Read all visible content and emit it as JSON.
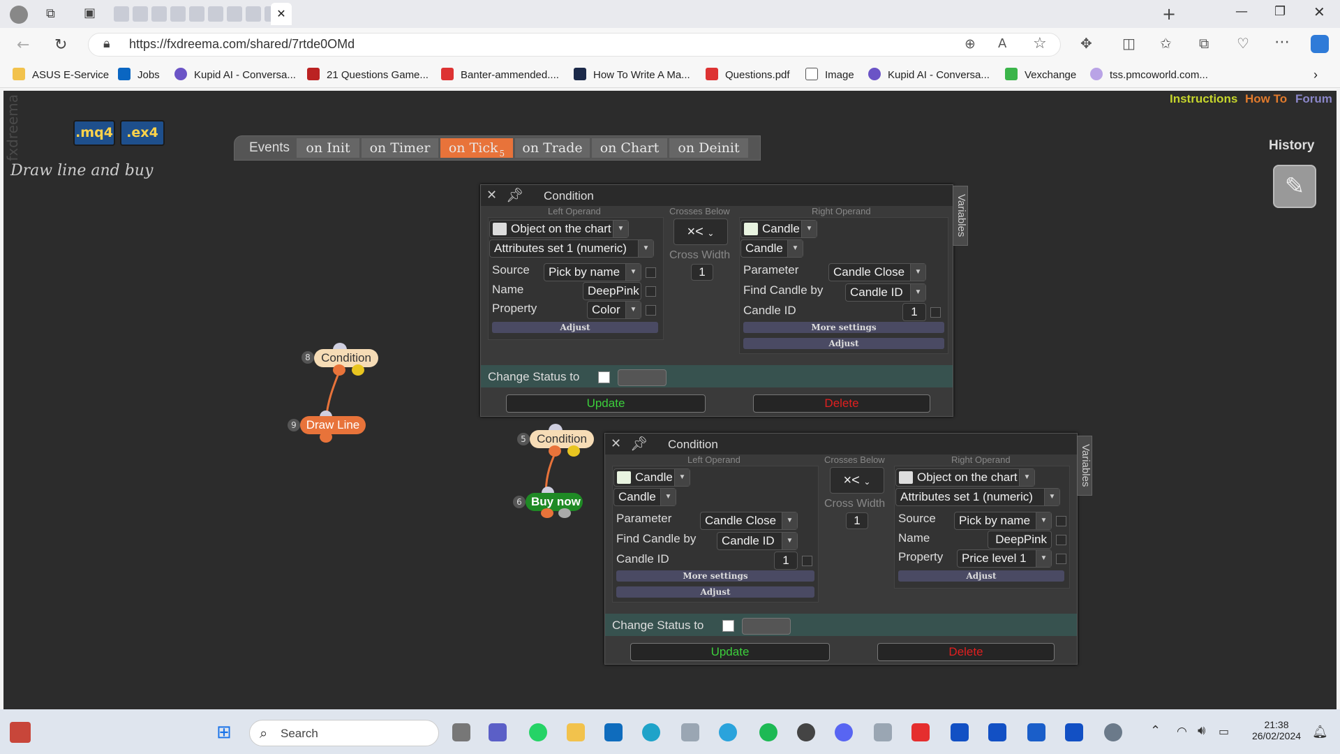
{
  "browser": {
    "url": "https://fxdreema.com/shared/7rtde0OMd",
    "bookmarks": [
      "ASUS E-Service",
      "Jobs",
      "Kupid AI - Conversa...",
      "21 Questions Game...",
      "Banter-ammended....",
      "How To Write A Ma...",
      "Questions.pdf",
      "Image",
      "Kupid AI - Conversa...",
      "Vexchange",
      "tss.pmcoworld.com..."
    ]
  },
  "app": {
    "brand": "fxdreema",
    "mq4_label": ".mq4",
    "ex4_label": ".ex4",
    "project_name": "Draw line and buy",
    "links": {
      "instructions": "Instructions",
      "howto": "How To",
      "forum": "Forum",
      "history": "History"
    },
    "events": {
      "label": "Events",
      "tabs": [
        "on Init",
        "on Timer",
        "on Tick",
        "on Trade",
        "on Chart",
        "on Deinit"
      ],
      "active_tab": "on Tick",
      "active_count": "5"
    }
  },
  "nodes": [
    {
      "num": "8",
      "label": "Condition"
    },
    {
      "num": "9",
      "label": "Draw Line"
    },
    {
      "num": "5",
      "label": "Condition"
    },
    {
      "num": "6",
      "label": "Buy now"
    }
  ],
  "windows": [
    {
      "title": "Condition",
      "left_header": "Left Operand",
      "mid_header": "Crosses Below",
      "right_header": "Right Operand",
      "operator": "×<",
      "cross_width_label": "Cross Width",
      "cross_width": "1",
      "left": {
        "type": "Object on the chart",
        "subtype": "Attributes set 1 (numeric)",
        "rows": [
          {
            "label": "Source",
            "value": "Pick by name"
          },
          {
            "label": "Name",
            "value": "DeepPink"
          },
          {
            "label": "Property",
            "value": "Color"
          }
        ],
        "adjust": "Adjust"
      },
      "right": {
        "type": "Candle",
        "subtype": "Candle",
        "rows": [
          {
            "label": "Parameter",
            "value": "Candle Close"
          },
          {
            "label": "Find Candle by",
            "value": "Candle ID"
          },
          {
            "label": "Candle ID",
            "value": "1"
          }
        ],
        "more": "More settings",
        "adjust": "Adjust"
      },
      "status_label": "Change Status to",
      "update": "Update",
      "delete": "Delete",
      "variables": "Variables"
    },
    {
      "title": "Condition",
      "left_header": "Left Operand",
      "mid_header": "Crosses Below",
      "right_header": "Right Operand",
      "operator": "×<",
      "cross_width_label": "Cross Width",
      "cross_width": "1",
      "left": {
        "type": "Candle",
        "subtype": "Candle",
        "rows": [
          {
            "label": "Parameter",
            "value": "Candle Close"
          },
          {
            "label": "Find Candle by",
            "value": "Candle ID"
          },
          {
            "label": "Candle ID",
            "value": "1"
          }
        ],
        "more": "More settings",
        "adjust": "Adjust"
      },
      "right": {
        "type": "Object on the chart",
        "subtype": "Attributes set 1 (numeric)",
        "rows": [
          {
            "label": "Source",
            "value": "Pick by name"
          },
          {
            "label": "Name",
            "value": "DeepPink"
          },
          {
            "label": "Property",
            "value": "Price level 1"
          }
        ],
        "adjust": "Adjust"
      },
      "status_label": "Change Status to",
      "update": "Update",
      "delete": "Delete",
      "variables": "Variables"
    }
  ],
  "taskbar": {
    "search": "Search",
    "time": "21:38",
    "date": "26/02/2024"
  }
}
